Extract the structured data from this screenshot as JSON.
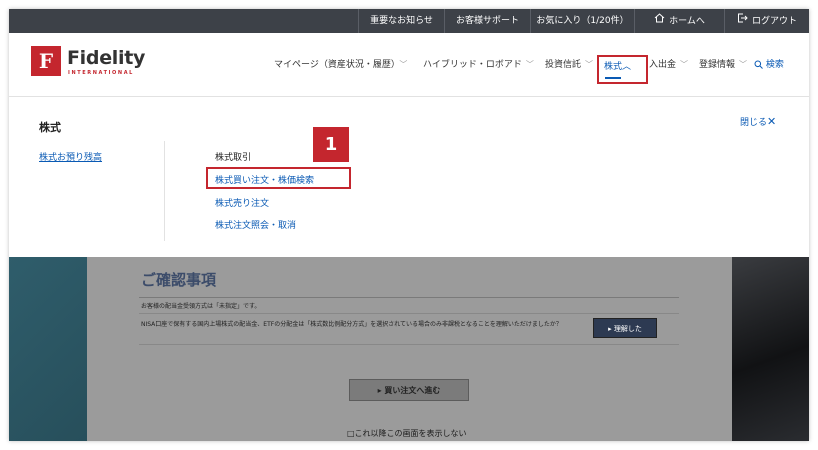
{
  "topbar": {
    "items": [
      {
        "label": "重要なお知らせ"
      },
      {
        "label": "お客様サポート"
      },
      {
        "label": "お気に入り（1/20件）"
      },
      {
        "label": "ホームへ"
      },
      {
        "label": "ログアウト"
      }
    ]
  },
  "brand": {
    "name": "Fidelity",
    "sub": "INTERNATIONAL",
    "mark": "F",
    "color": "#c4262e"
  },
  "nav": {
    "items": [
      {
        "label": "マイページ（資産状況・履歴）"
      },
      {
        "label": "ハイブリッド・ロボアド"
      },
      {
        "label": "投資信託"
      },
      {
        "label": "株式"
      },
      {
        "label": "入出金"
      },
      {
        "label": "登録情報"
      },
      {
        "label": "検索"
      }
    ]
  },
  "mega": {
    "title": "株式",
    "close_label": "閉じる",
    "left_link": "株式お預り残高",
    "section_title": "株式取引",
    "items": [
      {
        "label": "株式買い注文・株価検索"
      },
      {
        "label": "株式売り注文"
      },
      {
        "label": "株式注文照会・取消"
      }
    ],
    "callout_number": "1"
  },
  "background_page": {
    "title": "ご確認事項",
    "line1": "お客様の配当金受領方式は「未指定」です。",
    "line2": "NISA口座で保有する国内上場株式の配当金、ETFの分配金は「株式数比例配分方式」を選択されている場合のみ非課税となることを理解いただけましたか？",
    "ok_button": "理解した",
    "buy_button": "買い注文へ進む",
    "checkbox_label": "□これ以降この画面を表示しない"
  },
  "colors": {
    "accent": "#c4262e",
    "link": "#0a5ab4",
    "topbar": "#3d4148"
  }
}
